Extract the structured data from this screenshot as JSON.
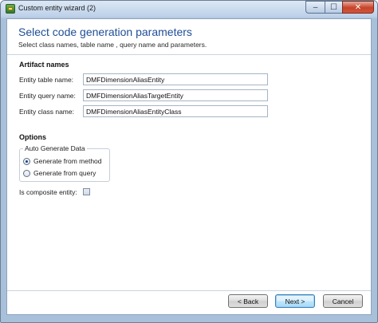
{
  "window": {
    "title": "Custom entity wizard (2)",
    "controls": {
      "minimize": "–",
      "maximize": "☐",
      "close": "✕"
    }
  },
  "header": {
    "title": "Select code generation parameters",
    "subtitle": "Select class names, table name , query name and parameters."
  },
  "artifact_names": {
    "section_title": "Artifact names",
    "fields": [
      {
        "label": "Entity table name:",
        "value": "DMFDimensionAliasEntity"
      },
      {
        "label": "Entity query name:",
        "value": "DMFDimensionAliasTargetEntity"
      },
      {
        "label": "Entity class name:",
        "value": "DMFDimensionAliasEntityClass"
      }
    ]
  },
  "options": {
    "section_title": "Options",
    "group_label": "Auto Generate Data",
    "radios": [
      {
        "label": "Generate from method",
        "checked": true
      },
      {
        "label": "Generate from query",
        "checked": false
      }
    ],
    "composite_label": "Is composite entity:",
    "composite_checked": false
  },
  "buttons": {
    "back": "< Back",
    "next": "Next >",
    "cancel": "Cancel"
  }
}
